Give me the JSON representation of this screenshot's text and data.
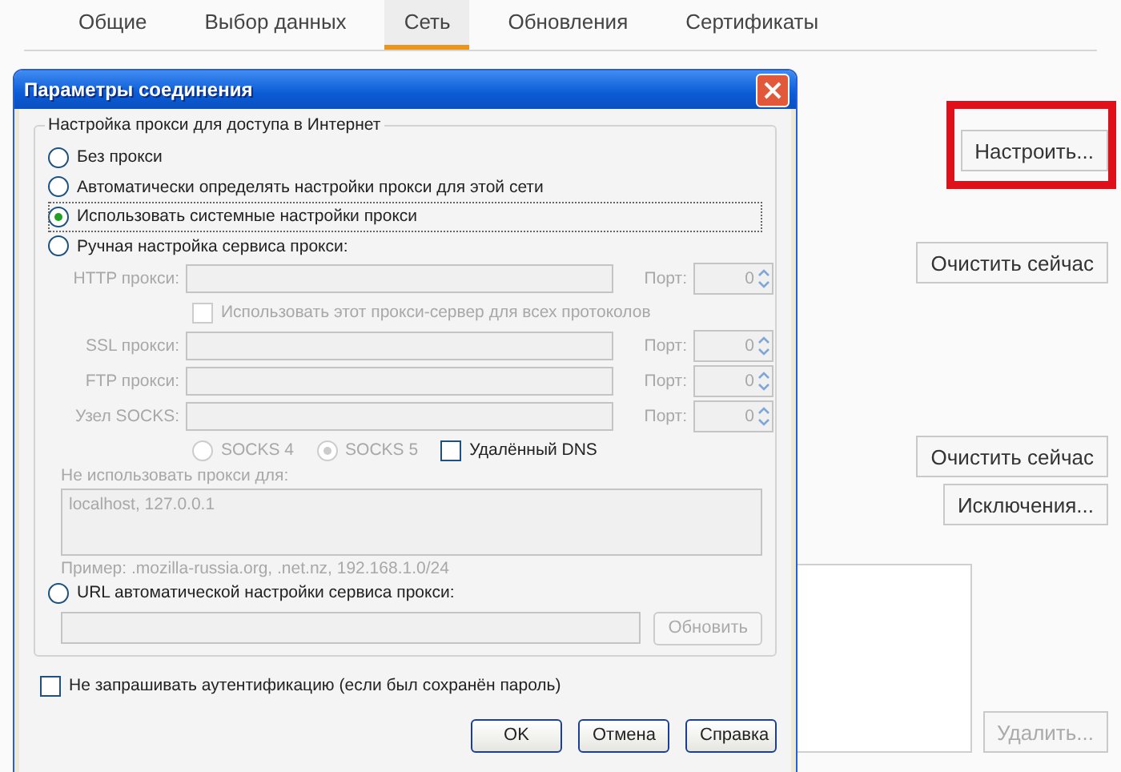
{
  "tabs": [
    {
      "label": "Общие",
      "selected": false
    },
    {
      "label": "Выбор данных",
      "selected": false
    },
    {
      "label": "Сеть",
      "selected": true
    },
    {
      "label": "Обновления",
      "selected": false
    },
    {
      "label": "Сертификаты",
      "selected": false
    }
  ],
  "page_buttons": [
    {
      "label": "Настроить...",
      "highlighted": true,
      "disabled": false
    },
    {
      "label": "Очистить сейчас",
      "highlighted": false,
      "disabled": false
    },
    {
      "label": "Очистить сейчас",
      "highlighted": false,
      "disabled": false
    },
    {
      "label": "Исключения...",
      "highlighted": false,
      "disabled": false
    },
    {
      "label": "Удалить...",
      "highlighted": false,
      "disabled": true
    }
  ],
  "dialog": {
    "title": "Параметры соединения",
    "group_title": "Настройка прокси для доступа в Интернет",
    "options": [
      {
        "label": "Без прокси",
        "selected": false
      },
      {
        "label": "Автоматически определять настройки прокси для этой сети",
        "selected": false
      },
      {
        "label": "Использовать системные настройки прокси",
        "selected": true
      },
      {
        "label": "Ручная настройка сервиса прокси:",
        "selected": false
      },
      {
        "label": "URL автоматической настройки сервиса прокси:",
        "selected": false
      }
    ],
    "manual": {
      "disabled": true,
      "proxy_rows": [
        {
          "label": "HTTP прокси:",
          "port_label": "Порт:",
          "port": "0"
        },
        {
          "label": "SSL прокси:",
          "port_label": "Порт:",
          "port": "0"
        },
        {
          "label": "FTP прокси:",
          "port_label": "Порт:",
          "port": "0"
        },
        {
          "label": "Узел SOCKS:",
          "port_label": "Порт:",
          "port": "0"
        }
      ],
      "use_for_all": {
        "label": "Использовать этот прокси-сервер для всех протоколов",
        "checked": false
      },
      "socks_versions": [
        {
          "label": "SOCKS 4",
          "selected": false
        },
        {
          "label": "SOCKS 5",
          "selected": true
        }
      ],
      "remote_dns": {
        "label": "Удалённый DNS",
        "checked": false
      },
      "no_proxy_label": "Не использовать прокси для:",
      "no_proxy_value": "localhost, 127.0.0.1",
      "example": "Пример: .mozilla-russia.org, .net.nz, 192.168.1.0/24"
    },
    "refresh_button": "Обновить",
    "no_auth": {
      "label": "Не запрашивать аутентификацию (если был сохранён пароль)",
      "checked": false
    },
    "buttons": [
      "OK",
      "Отмена",
      "Справка"
    ]
  }
}
